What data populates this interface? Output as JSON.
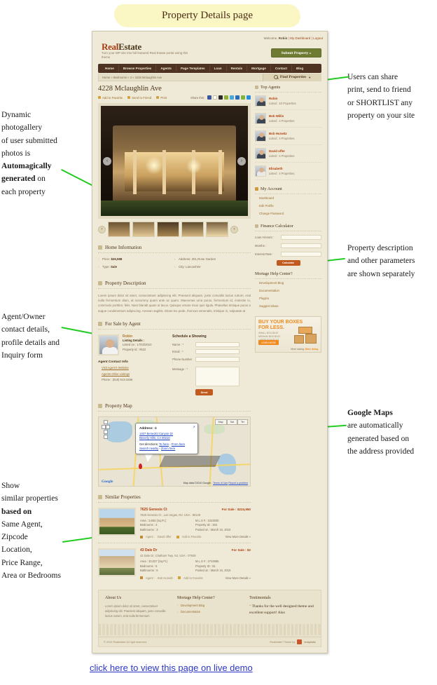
{
  "banner": {
    "title": "Property Details page"
  },
  "demo_link": "click here to view  this page on live demo",
  "annotations": {
    "left": [
      {
        "id": "gallery",
        "lines": [
          "Dynamic",
          "photogallery",
          "of user submitted",
          "photos is",
          "Automagically",
          "generated on",
          "each property"
        ],
        "bold": [
          "Automagically",
          "generated"
        ]
      },
      {
        "id": "agent",
        "lines": [
          "Agent/Owner",
          "contact details,",
          "profile details and",
          "Inquiry form"
        ],
        "bold": []
      },
      {
        "id": "similar",
        "lines": [
          "Show",
          "similar properties",
          "based on",
          "Same Agent,",
          "Zipcode",
          "Location,",
          "Price Range,",
          "Area or Bedrooms"
        ],
        "bold": [
          "based on"
        ]
      }
    ],
    "right": [
      {
        "id": "share",
        "lines": [
          "Users can share",
          "print, send to friend",
          "or SHORTLIST any",
          "property on your site"
        ],
        "bold": []
      },
      {
        "id": "description",
        "lines": [
          "Property description",
          "and other parameters",
          "are shown separately"
        ],
        "bold": []
      },
      {
        "id": "maps",
        "lines": [
          "Google Maps",
          "are automatically",
          "generated based on",
          "the address provided"
        ],
        "bold": [
          "Google Maps"
        ]
      }
    ]
  },
  "site": {
    "welcome_prefix": "Welcome,",
    "welcome_user": "Robin",
    "dashboard_link": "My Dashboard",
    "logout_link": "Logout",
    "logo_first": "Real",
    "logo_second": "Estate",
    "tagline": "Turn your WP site into full featured Real Estate portal using this theme",
    "submit_button": "Submit Property  »",
    "nav": [
      "Home",
      "Browse Properties",
      "Agents",
      "Page Templates",
      "Loan",
      "Rentals",
      "Mortgage",
      "Contact",
      "Blog"
    ],
    "breadcrumb": "Home » Bedrooms » 3 » 4228 Mclaughlin Ave",
    "find_properties": "Find Properties"
  },
  "property": {
    "title": "4228 Mclaughlin Ave",
    "actions": [
      "Add to Favorite",
      "Send to Friend",
      "Print"
    ],
    "share_label": "Share this:",
    "share_colors": [
      "#3b5998",
      "#ffffff",
      "#2b2b2b",
      "#8fae3c",
      "#4aa7d8",
      "#2a6ebb",
      "#7cb342",
      "#2a8fd8"
    ],
    "gallery_prev": "‹",
    "gallery_next": "›",
    "thumb_prev": "‹",
    "thumb_next": "›"
  },
  "home_information": {
    "heading": "Home Information",
    "rows_left": [
      {
        "label": "Price:",
        "value": "$26,598"
      },
      {
        "label": "Type:",
        "value": "Sale"
      }
    ],
    "rows_right": [
      {
        "label": "Address:",
        "value": "201,Rose Garden"
      },
      {
        "label": "City:",
        "value": "Lancashire"
      }
    ]
  },
  "property_description": {
    "heading": "Property Description",
    "text": "Lorem ipsum dolor sit amet, consectetuer adipiscing elit. Praesent aliquam, justo convallis luctus rutrum, erat nulla fermentum diam, at nonummy quam ante ac quam. Maecenas urna purus, fermentum id, molestie in, commodo porttitor, felis. Nam blandit quam ut lacus. Quisque ornare risus quis ligula. Phasellus tristique purus a augue condimentum adipiscing. Aenean sagittis. Etiam leo pede, rhoncus venenatis, tristique in, vulputate at"
  },
  "for_sale_by_agent": {
    "heading": "For Sale by Agent",
    "agent_name": "Robin",
    "listing_details_label": "Listing Details :",
    "listed_on": "Listed on : 17/03/2010",
    "property_id": "Property Id : #622",
    "contact_info_heading": "Agent Contact Info",
    "links": [
      "Visit Agent's Website",
      "Agents Other Listings"
    ],
    "phone": "Phone : (818) 913-3456",
    "form_heading": "Schedule a Showing",
    "fields": [
      {
        "label": "Name : *",
        "value": ""
      },
      {
        "label": "Email : *",
        "value": ""
      },
      {
        "label": "Phone Number :",
        "value": ""
      },
      {
        "label": "Message : *",
        "value": ""
      }
    ],
    "send_button": "Send"
  },
  "property_map": {
    "heading": "Property Map",
    "bubble_title": "Address:",
    "bubble_address": [
      "1407 Benedict Canyon Dr",
      "Beverly Hills, CA 90210"
    ],
    "directions_label": "Get directions:",
    "directions_links": [
      "To here",
      "From here",
      "Search nearby",
      "Zoom here"
    ],
    "map_types": [
      "Map",
      "Sat",
      "Ter"
    ],
    "attribution": "Map data ©2010 Google -",
    "terms": "Terms of Use",
    "report": "Report a problem",
    "google_mark": "Google"
  },
  "similar_properties": {
    "heading": "Similar Properties",
    "items": [
      {
        "name": "7625 Genesis Ct",
        "status": "For Sale : ",
        "price": "$224,950",
        "address": "7625 Genesis Ct , Las Vegas, NV, USA - 89128",
        "specs_left": [
          {
            "label": "Area",
            "value": ": 2,663 (Sq.Ft.)"
          },
          {
            "label": "Bedrooms",
            "value": ": 3"
          },
          {
            "label": "Bathrooms",
            "value": ": 3"
          }
        ],
        "specs_right": [
          {
            "label": "M.L.S #",
            "value": ": 1023030"
          },
          {
            "label": "Property ID",
            "value": ": 183"
          },
          {
            "label": "Posted on",
            "value": ": March 16, 2010"
          }
        ],
        "agent_label": "Agent :",
        "agent_name": "David offer",
        "favorite": "Add to Favorite",
        "more": "View More Details »"
      },
      {
        "name": "43 Dale Dr",
        "status": "For Sale : ",
        "price": "$2",
        "address": "43 Dale Dr, Chatham Twp, NJ, USA - 07928",
        "specs_left": [
          {
            "label": "Area",
            "value": ": 20,037 (Sq.Ft.)"
          },
          {
            "label": "Bedrooms",
            "value": ": 6"
          },
          {
            "label": "Bathrooms",
            "value": ": 6"
          }
        ],
        "specs_right": [
          {
            "label": "M.L.S #",
            "value": ": 2744585"
          },
          {
            "label": "Property ID",
            "value": ": 91"
          },
          {
            "label": "Posted on",
            "value": ": March 16, 2010"
          }
        ],
        "agent_label": "Agent :",
        "agent_name": "Bob Hurwitz",
        "favorite": "Add to Favorite",
        "more": "View More Details »"
      }
    ]
  },
  "sidebar": {
    "top_agents": {
      "heading": "Top Agents",
      "agents": [
        {
          "name": "Robin",
          "listed": "Listed : 10 Properties"
        },
        {
          "name": "Bob Willis",
          "listed": "Listed : 4 Properties"
        },
        {
          "name": "Bob Hurwitz",
          "listed": "Listed : 4 Properties"
        },
        {
          "name": "David offer",
          "listed": "Listed : 4 Properties"
        },
        {
          "name": "Elisabeth",
          "listed": "Listed : 4 Properties"
        }
      ]
    },
    "my_account": {
      "heading": "My Account",
      "links": [
        "Dashboard",
        "Edit Profile",
        "Change Password"
      ]
    },
    "finance_calculator": {
      "heading": "Finance Calculator",
      "fields": [
        {
          "label": "Loan Amount :",
          "value": ""
        },
        {
          "label": "Months :",
          "value": ""
        },
        {
          "label": "Interest Rate :",
          "value": ""
        }
      ],
      "button": "Calculate"
    },
    "mortage_help": {
      "heading": "Mortage Help Center?",
      "links": [
        "Development Blog",
        "Documentation",
        "Plugins",
        "Suggest Ideas"
      ]
    },
    "ad": {
      "title_line1": "BUY YOUR BOXES",
      "title_line2": "FOR LESS.",
      "sub_lines": [
        "SMALL BOX $0.67",
        "MEDIUM BOX $0.87",
        "LARGE BOX $1.07"
      ],
      "button": "LEARN MORE",
      "footer_a": "More saving.",
      "footer_b": "More doing."
    }
  },
  "footer": {
    "about": {
      "heading": "About Us",
      "text": "Lorem ipsum dolor sit amet, consectetuer adipiscing elit. Praesent aliquam, justo convallis luctus rutrum, erat nulla fermentum"
    },
    "mortage": {
      "heading": "Mortage Help Center?",
      "links": [
        "Development Blog",
        "Documentation"
      ]
    },
    "testimonials": {
      "heading": "Testimonials",
      "quote_mark": "“",
      "quote": "Thanks for the well designed theme and excellent support! Also"
    },
    "copyright": "© 2010 Realestate All right reserved.",
    "powered_by": "Realestate Theme by",
    "brand": "templatic"
  }
}
